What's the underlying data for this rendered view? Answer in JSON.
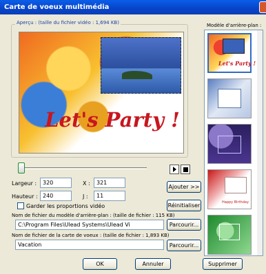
{
  "window": {
    "title": "Carte de voeux multimédia"
  },
  "preview": {
    "group_label": "Aperçu : (taille du fichier vidéo : 1,694 KB)",
    "card_text": "Let's Party !"
  },
  "playback": {
    "play_icon": "play-icon",
    "stop_icon": "stop-icon",
    "slider_position": 0
  },
  "fields": {
    "width_label": "Largeur :",
    "width_value": "320",
    "height_label": "Hauteur :",
    "height_value": "240",
    "x_label": "X :",
    "x_value": "321",
    "y_label": "J :",
    "y_value": "11",
    "keep_ratio_label": "Garder les proportions vidéo",
    "keep_ratio_checked": false
  },
  "background": {
    "label": "Nom de fichier du modèle d'arrière-plan : (taille de fichier : 115 KB)",
    "path": "C:\\Program Files\\Ulead Systems\\Ulead Vi",
    "browse": "Parcourir..."
  },
  "card_file": {
    "label": "Nom de fichier de la carte de voeux : (taille de fichier : 1,893 KB)",
    "name": "Vacation",
    "browse": "Parcourir..."
  },
  "buttons": {
    "add": "Ajouter >>",
    "reset": "Réinitialiser",
    "ok": "OK",
    "cancel": "Annuler",
    "delete": "Supprimer"
  },
  "templates": {
    "label": "Modèle d'arrière-plan :",
    "items": [
      {
        "text": "Let's Party !"
      },
      {
        "text": ""
      },
      {
        "text": ""
      },
      {
        "text": "Happy Birthday"
      },
      {
        "text": ""
      }
    ]
  }
}
